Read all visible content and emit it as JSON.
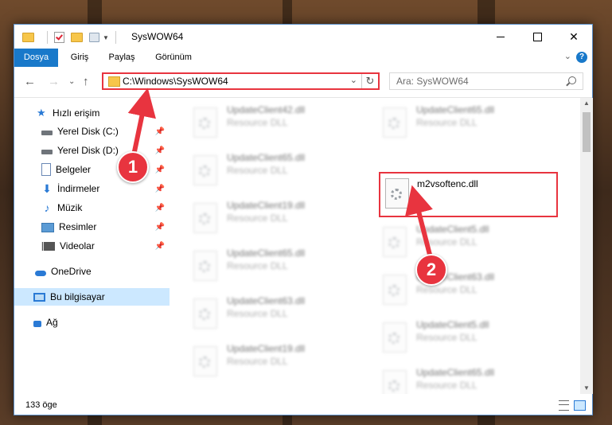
{
  "window": {
    "title": "SysWOW64",
    "controls": {
      "minimize": "–",
      "maximize": "☐",
      "close": "✕"
    }
  },
  "ribbon": {
    "tabs": [
      "Dosya",
      "Giriş",
      "Paylaş",
      "Görünüm"
    ],
    "active_tab": "Dosya",
    "help": "?",
    "toggle": "⌄"
  },
  "address": {
    "path": "C:\\Windows\\SysWOW64",
    "dropdown": "⌄",
    "refresh": "↻"
  },
  "search": {
    "placeholder": "Ara: SysWOW64"
  },
  "nav": {
    "back": "←",
    "forward": "→",
    "recent": "⌄",
    "up": "↑",
    "items": [
      {
        "label": "Hızlı erişim",
        "icon": "star-icon",
        "pinned": false
      },
      {
        "label": "Yerel Disk (C:)",
        "icon": "drive-icon",
        "pinned": true
      },
      {
        "label": "Yerel Disk (D:)",
        "icon": "drive-icon",
        "pinned": true
      },
      {
        "label": "Belgeler",
        "icon": "document-icon",
        "pinned": true
      },
      {
        "label": "İndirmeler",
        "icon": "download-icon",
        "pinned": true
      },
      {
        "label": "Müzik",
        "icon": "music-icon",
        "pinned": true
      },
      {
        "label": "Resimler",
        "icon": "picture-icon",
        "pinned": true
      },
      {
        "label": "Videolar",
        "icon": "video-icon",
        "pinned": true
      },
      {
        "label": "OneDrive",
        "icon": "cloud-icon",
        "pinned": false
      },
      {
        "label": "Bu bilgisayar",
        "icon": "computer-icon",
        "pinned": false,
        "selected": true
      },
      {
        "label": "Ağ",
        "icon": "network-icon",
        "pinned": false
      }
    ]
  },
  "files": {
    "left": [
      {
        "name": "UpdateClient42.dll",
        "type": "Resource DLL"
      },
      {
        "name": "UpdateClient65.dll",
        "type": "Resource DLL"
      },
      {
        "name": "UpdateClient19.dll",
        "type": "Resource DLL"
      },
      {
        "name": "UpdateClient65.dll",
        "type": "Resource DLL"
      },
      {
        "name": "UpdateClient63.dll",
        "type": "Resource DLL"
      },
      {
        "name": "UpdateClient19.dll",
        "type": "Resource DLL"
      }
    ],
    "right": [
      {
        "name": "UpdateClient65.dll",
        "type": "Resource DLL"
      },
      {
        "name": "m2vsoftenc.dll",
        "type": "",
        "highlight": true
      },
      {
        "name": "UpdateClient5.dll",
        "type": "Resource DLL"
      },
      {
        "name": "UpdateClient63.dll",
        "type": "Resource DLL"
      },
      {
        "name": "UpdateClient5.dll",
        "type": "Resource DLL"
      },
      {
        "name": "UpdateClient65.dll",
        "type": "Resource DLL"
      }
    ]
  },
  "status": {
    "item_count": "133 öge"
  },
  "annotations": {
    "badge1": "1",
    "badge2": "2",
    "color": "#e8343f"
  }
}
